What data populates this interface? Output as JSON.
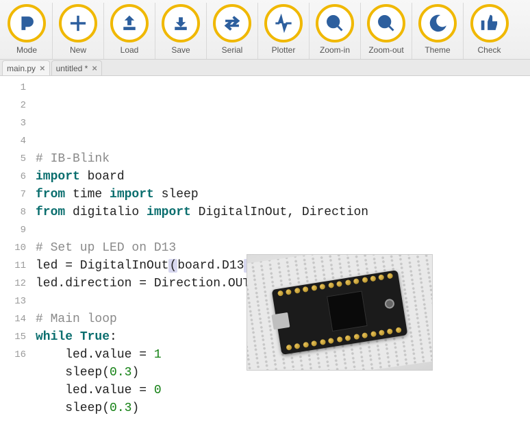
{
  "toolbar": {
    "buttons": [
      {
        "id": "mode",
        "label": "Mode",
        "icon": "mode"
      },
      {
        "id": "new",
        "label": "New",
        "icon": "plus"
      },
      {
        "id": "load",
        "label": "Load",
        "icon": "upload"
      },
      {
        "id": "save",
        "label": "Save",
        "icon": "download"
      },
      {
        "id": "serial",
        "label": "Serial",
        "icon": "arrows"
      },
      {
        "id": "plotter",
        "label": "Plotter",
        "icon": "pulse"
      },
      {
        "id": "zoomin",
        "label": "Zoom-in",
        "icon": "zoom-in"
      },
      {
        "id": "zoomout",
        "label": "Zoom-out",
        "icon": "zoom-out"
      },
      {
        "id": "theme",
        "label": "Theme",
        "icon": "moon"
      },
      {
        "id": "check",
        "label": "Check",
        "icon": "thumb"
      }
    ]
  },
  "tabs": [
    {
      "label": "main.py",
      "dirty": false,
      "active": true
    },
    {
      "label": "untitled *",
      "dirty": true,
      "active": false
    }
  ],
  "editor": {
    "cursor_line": 7,
    "lines": [
      {
        "n": 1,
        "tokens": [
          {
            "t": "# IB-Blink",
            "c": "comment"
          }
        ]
      },
      {
        "n": 2,
        "tokens": [
          {
            "t": "import",
            "c": "keyword"
          },
          {
            "t": " board",
            "c": "ident"
          }
        ]
      },
      {
        "n": 3,
        "tokens": [
          {
            "t": "from",
            "c": "keyword"
          },
          {
            "t": " time ",
            "c": "ident"
          },
          {
            "t": "import",
            "c": "keyword"
          },
          {
            "t": " sleep",
            "c": "ident"
          }
        ]
      },
      {
        "n": 4,
        "tokens": [
          {
            "t": "from",
            "c": "keyword"
          },
          {
            "t": " digitalio ",
            "c": "ident"
          },
          {
            "t": "import",
            "c": "keyword"
          },
          {
            "t": " DigitalInOut, Direction",
            "c": "ident"
          }
        ]
      },
      {
        "n": 5,
        "tokens": []
      },
      {
        "n": 6,
        "tokens": [
          {
            "t": "# Set up LED on D13",
            "c": "comment"
          }
        ]
      },
      {
        "n": 7,
        "tokens": [
          {
            "t": "led = DigitalInOut",
            "c": "ident"
          },
          {
            "t": "(",
            "c": "hl"
          },
          {
            "t": "board.D13",
            "c": "ident"
          },
          {
            "t": ")",
            "c": "hl"
          },
          {
            "t": "",
            "c": "cursor"
          }
        ]
      },
      {
        "n": 8,
        "tokens": [
          {
            "t": "led.direction = Direction.OUTPUT",
            "c": "ident"
          }
        ]
      },
      {
        "n": 9,
        "tokens": []
      },
      {
        "n": 10,
        "tokens": [
          {
            "t": "# Main loop",
            "c": "comment"
          }
        ]
      },
      {
        "n": 11,
        "tokens": [
          {
            "t": "while",
            "c": "keyword"
          },
          {
            "t": " ",
            "c": "ident"
          },
          {
            "t": "True",
            "c": "keyword2"
          },
          {
            "t": ":",
            "c": "op"
          }
        ]
      },
      {
        "n": 12,
        "tokens": [
          {
            "t": "    led.value = ",
            "c": "ident"
          },
          {
            "t": "1",
            "c": "num"
          }
        ]
      },
      {
        "n": 13,
        "tokens": [
          {
            "t": "    sleep(",
            "c": "ident"
          },
          {
            "t": "0.3",
            "c": "num"
          },
          {
            "t": ")",
            "c": "ident"
          }
        ]
      },
      {
        "n": 14,
        "tokens": [
          {
            "t": "    led.value = ",
            "c": "ident"
          },
          {
            "t": "0",
            "c": "num"
          }
        ]
      },
      {
        "n": 15,
        "tokens": [
          {
            "t": "    sleep(",
            "c": "ident"
          },
          {
            "t": "0.3",
            "c": "num"
          },
          {
            "t": ")",
            "c": "ident"
          }
        ]
      },
      {
        "n": 16,
        "tokens": []
      }
    ]
  },
  "overlay_image": {
    "alt": "ItsyBitsy microcontroller board on breadboard"
  }
}
